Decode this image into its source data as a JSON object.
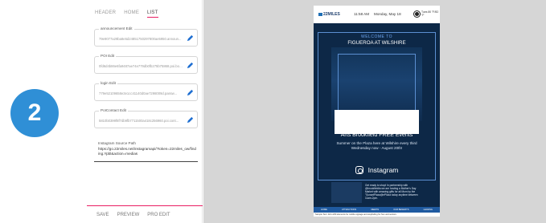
{
  "step": {
    "number": "2",
    "color": "#2f8fd6"
  },
  "tabs": [
    {
      "label": "HEADER"
    },
    {
      "label": "HOME"
    },
    {
      "label": "LIST"
    }
  ],
  "fields": [
    {
      "label": "announcement Edit",
      "value": "79e9077a29ba8e5d24851750297800ae5950.announ...",
      "icon": "pencil-icon"
    },
    {
      "label": "POI Edit",
      "value": "0fd6d4b86e6fa9487ae74e779db0fb275b75868.poi.boar...",
      "icon": "pencil-icon"
    },
    {
      "label": "login Edit",
      "value": "779e52109658e3e1cc41140d0ae7298009d.passw...",
      "icon": "pencil-icon"
    },
    {
      "label": "PoIContact Edit",
      "value": "5810b0399f8f7db9fb7711500a418c256960.poi.cont...",
      "icon": "pencil-icon"
    }
  ],
  "source": {
    "label": "Instagram Source Path",
    "value": "https://go.22miles.net/instagramapi/?token=22miles_ow/finding.Ypbl&action=medias"
  },
  "footer": {
    "save": "SAVE",
    "preview": "PREVIEW",
    "pro_edit": "PRO EDIT"
  },
  "screen": {
    "logo": "22MILES",
    "time": "11:58 AM",
    "date": "Monday, May 18",
    "weather": "Tues 80 °F/82 °F",
    "welcome": "WELCOME TO",
    "welcome_sub": "FIGUEROA AT WILSHIRE",
    "events_title": "Arts Brookfield FREE Events",
    "events_text": "Summer on the Plaza here at Wilshire every third Wednesday now - August 20th!",
    "instagram": "Instagram",
    "instagram_caption": "Get ready to shop! In partnership with @brookfieldla we are hosting a Mother's Day Market with amazing gifts for all Mom by the \"SunsetPlaza@ePlaza today anytime between 11am-2pm.",
    "nav": [
      "HOME",
      "ATTRACTIONS",
      "MEETIN",
      "OUR BENEFITS",
      "LEASING"
    ],
    "disclaimer": "Sample Text: 22mi.200 elements for mobile signage and wayfinding for Sun and seniors."
  },
  "colors": {
    "accent": "#e91e63",
    "screen_bg": "#0d2847",
    "nav_bg": "#1f5aa0",
    "pencil": "#1f6fd1"
  }
}
